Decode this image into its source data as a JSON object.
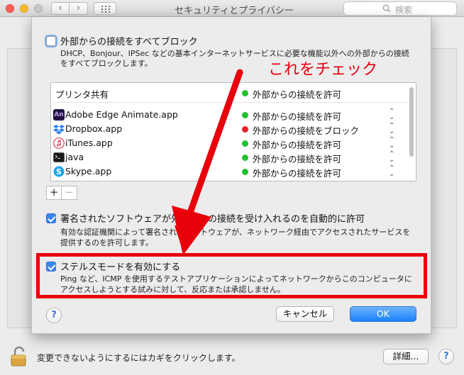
{
  "window": {
    "title": "セキュリティとプライバシー",
    "search_placeholder": "検索"
  },
  "colors": {
    "accent": "#3a86f0",
    "annotation": "#e8000b",
    "status_allow": "#22c32e",
    "status_block": "#f0202a"
  },
  "firewall": {
    "block_all": {
      "label": "外部からの接続をすべてブロック",
      "checked": false,
      "desc_line1": "DHCP、Bonjour、IPSec などの基本インターネットサービスに必要な機能以外への外部からの接続",
      "desc_line2": "をすべてブロックします。"
    },
    "apps": [
      {
        "name": "プリンタ共有",
        "status": "外部からの接続を許可",
        "status_color": "allow",
        "icon": "none"
      },
      {
        "name": "Adobe Edge Animate.app",
        "status": "外部からの接続を許可",
        "status_color": "allow",
        "icon": "adobe-edge-animate-icon"
      },
      {
        "name": "Dropbox.app",
        "status": "外部からの接続をブロック",
        "status_color": "block",
        "icon": "dropbox-icon"
      },
      {
        "name": "iTunes.app",
        "status": "外部からの接続を許可",
        "status_color": "allow",
        "icon": "itunes-icon"
      },
      {
        "name": "java",
        "status": "外部からの接続を許可",
        "status_color": "allow",
        "icon": "terminal-icon"
      },
      {
        "name": "Skype.app",
        "status": "外部からの接続を許可",
        "status_color": "allow",
        "icon": "skype-icon"
      }
    ],
    "add_label": "+",
    "remove_label": "−",
    "auto_allow": {
      "label": "署名されたソフトウェアが外部からの接続を受け入れるのを自動的に許可",
      "checked": true,
      "desc_line1": "有効な認証機関によって署名されたソフトウェアが、ネットワーク経由でアクセスされたサービスを",
      "desc_line2": "提供するのを許可します。"
    },
    "stealth": {
      "label": "ステルスモードを有効にする",
      "checked": true,
      "desc_line1": "Ping など、ICMP を使用するテストアプリケーションによってネットワークからこのコンピュータに",
      "desc_line2": "アクセスしようとする試みに対して、反応または承認しません。"
    },
    "cancel_label": "キャンセル",
    "ok_label": "OK",
    "help_label": "?"
  },
  "annotation": {
    "text": "これをチェック"
  },
  "footer": {
    "lock_text": "変更できないようにするにはカギをクリックします。",
    "detail_label": "詳細...",
    "help_label": "?"
  }
}
